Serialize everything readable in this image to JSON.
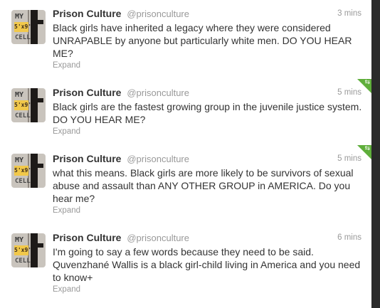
{
  "timeline": {
    "tweets": [
      {
        "name": "Prison Culture",
        "handle": "@prisonculture",
        "time": "3 mins",
        "text": "Black girls have inherited a legacy where they were considered UNRAPABLE by anyone but particularly white men. DO YOU HEAR ME?",
        "expand": "Expand",
        "retweeted": false
      },
      {
        "name": "Prison Culture",
        "handle": "@prisonculture",
        "time": "5 mins",
        "text": "Black girls are the fastest growing group in the juvenile justice system. DO YOU HEAR ME?",
        "expand": "Expand",
        "retweeted": true
      },
      {
        "name": "Prison Culture",
        "handle": "@prisonculture",
        "time": "5 mins",
        "text": "what this means. Black girls are more likely to be survivors of sexual abuse and assault than ANY OTHER GROUP in AMERICA. Do you hear me?",
        "expand": "Expand",
        "retweeted": true
      },
      {
        "name": "Prison Culture",
        "handle": "@prisonculture",
        "time": "6 mins",
        "text": "I'm going to say a few words because they need to be said. Quvenzhané Wallis is a black girl-child living in America and you need to know+",
        "expand": "Expand",
        "retweeted": false
      }
    ]
  },
  "avatar": {
    "top_text": "MY",
    "size_text": "5'x9'",
    "bottom_text": "CELL"
  },
  "colors": {
    "retweet_corner": "#5fae3b",
    "name": "#333333",
    "meta": "#999999",
    "scroll_gutter": "#2a2a2a"
  },
  "icons": {
    "retweet_corner": "retweet-icon"
  }
}
